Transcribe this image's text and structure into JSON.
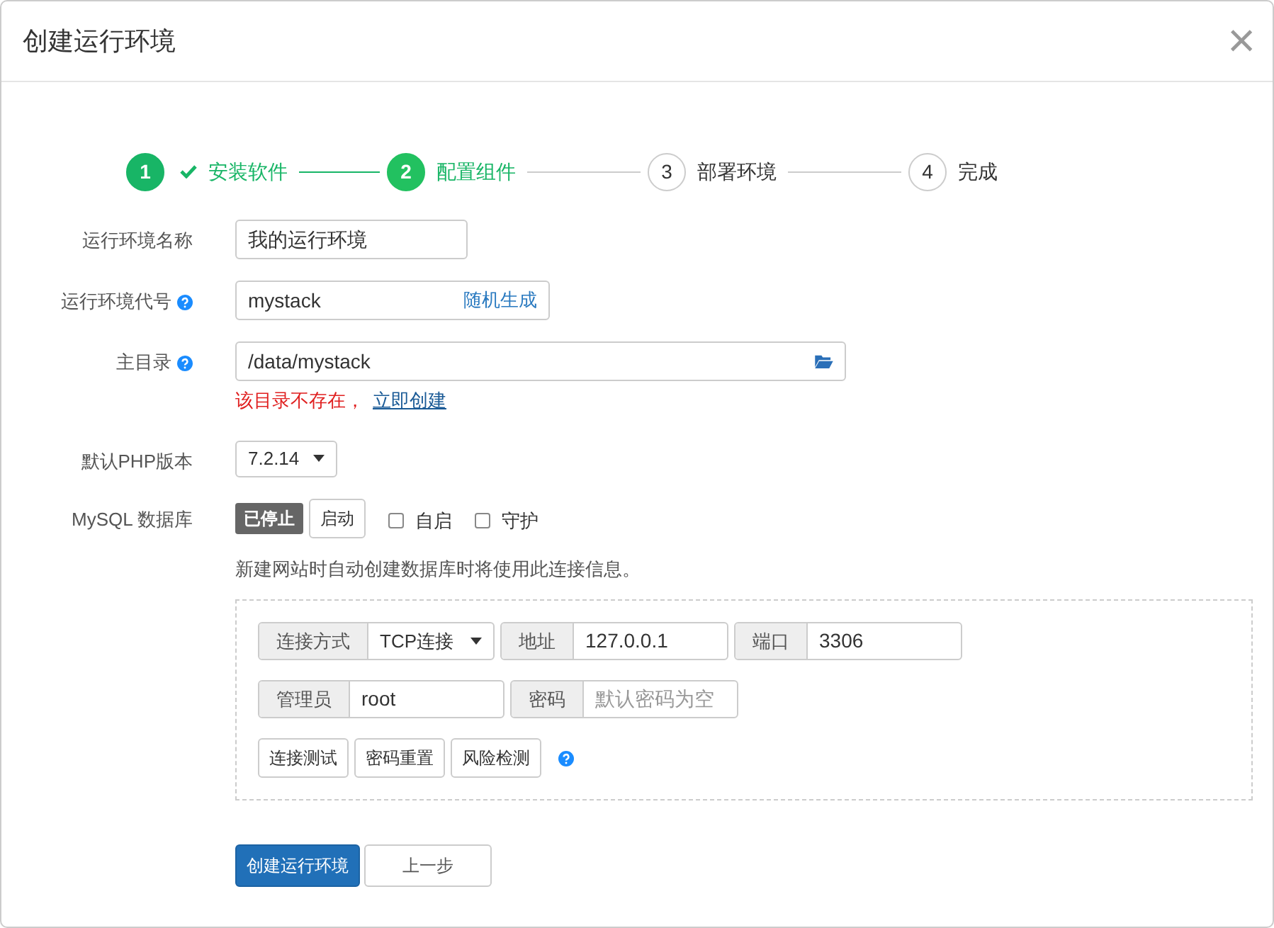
{
  "dialog": {
    "title": "创建运行环境",
    "close": "×"
  },
  "steps": [
    {
      "number": "1",
      "label": "安装软件",
      "completed": true,
      "selected": false
    },
    {
      "number": "2",
      "label": "配置组件",
      "completed": false,
      "selected": true
    },
    {
      "number": "3",
      "label": "部署环境",
      "completed": false,
      "selected": false
    },
    {
      "number": "4",
      "label": "完成",
      "completed": false,
      "selected": false
    }
  ],
  "form": {
    "name": {
      "label": "运行环境名称",
      "value": "我的运行环境"
    },
    "code": {
      "label": "运行环境代号",
      "help": true,
      "value": "mystack",
      "action": "随机生成"
    },
    "home": {
      "label": "主目录",
      "help": true,
      "value": "/data/mystack",
      "error": "该目录不存在，",
      "error_link": "立即创建"
    },
    "php": {
      "label": "默认PHP版本",
      "value": "7.2.14"
    },
    "mysql": {
      "label": "MySQL 数据库",
      "status": "已停止",
      "start_button": "启动",
      "options": [
        {
          "label": "自启",
          "checked": false
        },
        {
          "label": "守护",
          "checked": false
        }
      ],
      "hint": "新建网站时自动创建数据库时将使用此连接信息。",
      "connection": {
        "rows": [
          [
            {
              "kind": "select",
              "addon": "连接方式",
              "value": "TCP连接"
            },
            {
              "kind": "input",
              "addon": "地址",
              "value": "127.0.0.1"
            },
            {
              "kind": "input",
              "addon": "端口",
              "value": "3306"
            }
          ],
          [
            {
              "kind": "input",
              "addon": "管理员",
              "value": "root"
            },
            {
              "kind": "input",
              "addon": "密码",
              "placeholder": "默认密码为空"
            }
          ]
        ],
        "buttons": [
          "连接测试",
          "密码重置",
          "风险检测"
        ],
        "help": true
      }
    }
  },
  "footer": {
    "primary": "创建运行环境",
    "secondary": "上一步"
  }
}
